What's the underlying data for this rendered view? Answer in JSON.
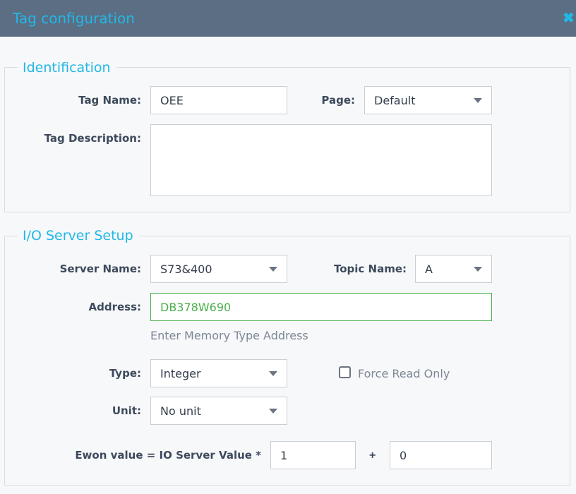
{
  "window": {
    "title": "Tag configuration",
    "close_glyph": "✖"
  },
  "identification": {
    "legend": "Identification",
    "tag_name_label": "Tag Name:",
    "tag_name_value": "OEE",
    "page_label": "Page:",
    "page_value": "Default",
    "description_label": "Tag Description:",
    "description_value": ""
  },
  "io_setup": {
    "legend": "I/O Server Setup",
    "server_name_label": "Server Name:",
    "server_name_value": "S73&400",
    "topic_name_label": "Topic Name:",
    "topic_name_value": "A",
    "address_label": "Address:",
    "address_value": "DB378W690",
    "address_hint": "Enter Memory Type Address",
    "type_label": "Type:",
    "type_value": "Integer",
    "force_read_only_label": "Force Read Only",
    "force_read_only_checked": false,
    "unit_label": "Unit:",
    "unit_value": "No unit",
    "scale_label": "Ewon value = IO Server Value *",
    "scale_value": "1",
    "plus": "+",
    "offset_value": "0"
  },
  "colors": {
    "accent": "#22b8e6",
    "titlebar": "#5b6e84",
    "valid_green": "#4ab04a"
  }
}
